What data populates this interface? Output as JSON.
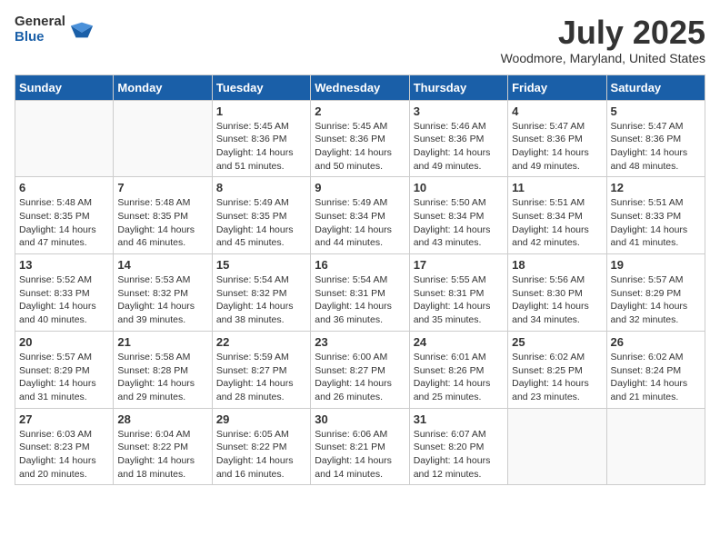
{
  "logo": {
    "general": "General",
    "blue": "Blue"
  },
  "title": "July 2025",
  "location": "Woodmore, Maryland, United States",
  "weekdays": [
    "Sunday",
    "Monday",
    "Tuesday",
    "Wednesday",
    "Thursday",
    "Friday",
    "Saturday"
  ],
  "weeks": [
    [
      {
        "day": "",
        "info": ""
      },
      {
        "day": "",
        "info": ""
      },
      {
        "day": "1",
        "info": "Sunrise: 5:45 AM\nSunset: 8:36 PM\nDaylight: 14 hours and 51 minutes."
      },
      {
        "day": "2",
        "info": "Sunrise: 5:45 AM\nSunset: 8:36 PM\nDaylight: 14 hours and 50 minutes."
      },
      {
        "day": "3",
        "info": "Sunrise: 5:46 AM\nSunset: 8:36 PM\nDaylight: 14 hours and 49 minutes."
      },
      {
        "day": "4",
        "info": "Sunrise: 5:47 AM\nSunset: 8:36 PM\nDaylight: 14 hours and 49 minutes."
      },
      {
        "day": "5",
        "info": "Sunrise: 5:47 AM\nSunset: 8:36 PM\nDaylight: 14 hours and 48 minutes."
      }
    ],
    [
      {
        "day": "6",
        "info": "Sunrise: 5:48 AM\nSunset: 8:35 PM\nDaylight: 14 hours and 47 minutes."
      },
      {
        "day": "7",
        "info": "Sunrise: 5:48 AM\nSunset: 8:35 PM\nDaylight: 14 hours and 46 minutes."
      },
      {
        "day": "8",
        "info": "Sunrise: 5:49 AM\nSunset: 8:35 PM\nDaylight: 14 hours and 45 minutes."
      },
      {
        "day": "9",
        "info": "Sunrise: 5:49 AM\nSunset: 8:34 PM\nDaylight: 14 hours and 44 minutes."
      },
      {
        "day": "10",
        "info": "Sunrise: 5:50 AM\nSunset: 8:34 PM\nDaylight: 14 hours and 43 minutes."
      },
      {
        "day": "11",
        "info": "Sunrise: 5:51 AM\nSunset: 8:34 PM\nDaylight: 14 hours and 42 minutes."
      },
      {
        "day": "12",
        "info": "Sunrise: 5:51 AM\nSunset: 8:33 PM\nDaylight: 14 hours and 41 minutes."
      }
    ],
    [
      {
        "day": "13",
        "info": "Sunrise: 5:52 AM\nSunset: 8:33 PM\nDaylight: 14 hours and 40 minutes."
      },
      {
        "day": "14",
        "info": "Sunrise: 5:53 AM\nSunset: 8:32 PM\nDaylight: 14 hours and 39 minutes."
      },
      {
        "day": "15",
        "info": "Sunrise: 5:54 AM\nSunset: 8:32 PM\nDaylight: 14 hours and 38 minutes."
      },
      {
        "day": "16",
        "info": "Sunrise: 5:54 AM\nSunset: 8:31 PM\nDaylight: 14 hours and 36 minutes."
      },
      {
        "day": "17",
        "info": "Sunrise: 5:55 AM\nSunset: 8:31 PM\nDaylight: 14 hours and 35 minutes."
      },
      {
        "day": "18",
        "info": "Sunrise: 5:56 AM\nSunset: 8:30 PM\nDaylight: 14 hours and 34 minutes."
      },
      {
        "day": "19",
        "info": "Sunrise: 5:57 AM\nSunset: 8:29 PM\nDaylight: 14 hours and 32 minutes."
      }
    ],
    [
      {
        "day": "20",
        "info": "Sunrise: 5:57 AM\nSunset: 8:29 PM\nDaylight: 14 hours and 31 minutes."
      },
      {
        "day": "21",
        "info": "Sunrise: 5:58 AM\nSunset: 8:28 PM\nDaylight: 14 hours and 29 minutes."
      },
      {
        "day": "22",
        "info": "Sunrise: 5:59 AM\nSunset: 8:27 PM\nDaylight: 14 hours and 28 minutes."
      },
      {
        "day": "23",
        "info": "Sunrise: 6:00 AM\nSunset: 8:27 PM\nDaylight: 14 hours and 26 minutes."
      },
      {
        "day": "24",
        "info": "Sunrise: 6:01 AM\nSunset: 8:26 PM\nDaylight: 14 hours and 25 minutes."
      },
      {
        "day": "25",
        "info": "Sunrise: 6:02 AM\nSunset: 8:25 PM\nDaylight: 14 hours and 23 minutes."
      },
      {
        "day": "26",
        "info": "Sunrise: 6:02 AM\nSunset: 8:24 PM\nDaylight: 14 hours and 21 minutes."
      }
    ],
    [
      {
        "day": "27",
        "info": "Sunrise: 6:03 AM\nSunset: 8:23 PM\nDaylight: 14 hours and 20 minutes."
      },
      {
        "day": "28",
        "info": "Sunrise: 6:04 AM\nSunset: 8:22 PM\nDaylight: 14 hours and 18 minutes."
      },
      {
        "day": "29",
        "info": "Sunrise: 6:05 AM\nSunset: 8:22 PM\nDaylight: 14 hours and 16 minutes."
      },
      {
        "day": "30",
        "info": "Sunrise: 6:06 AM\nSunset: 8:21 PM\nDaylight: 14 hours and 14 minutes."
      },
      {
        "day": "31",
        "info": "Sunrise: 6:07 AM\nSunset: 8:20 PM\nDaylight: 14 hours and 12 minutes."
      },
      {
        "day": "",
        "info": ""
      },
      {
        "day": "",
        "info": ""
      }
    ]
  ]
}
